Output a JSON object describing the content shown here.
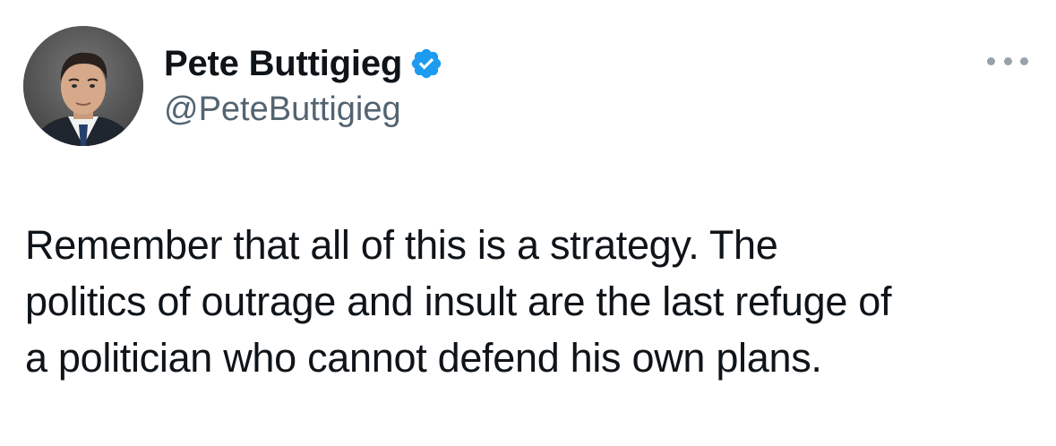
{
  "tweet": {
    "author": {
      "display_name": "Pete Buttigieg",
      "handle": "@PeteButtigieg",
      "verified": true,
      "avatar_icon": "profile-photo"
    },
    "text_lines": [
      "Remember that all of this is a strategy. The",
      "politics of outrage and insult are the last refuge of",
      "a politician who cannot defend his own plans."
    ],
    "more_icon": "more-options-icon"
  },
  "colors": {
    "text_primary": "#0f1419",
    "text_secondary": "#536471",
    "verified_blue": "#1d9bf0",
    "background": "#ffffff"
  }
}
